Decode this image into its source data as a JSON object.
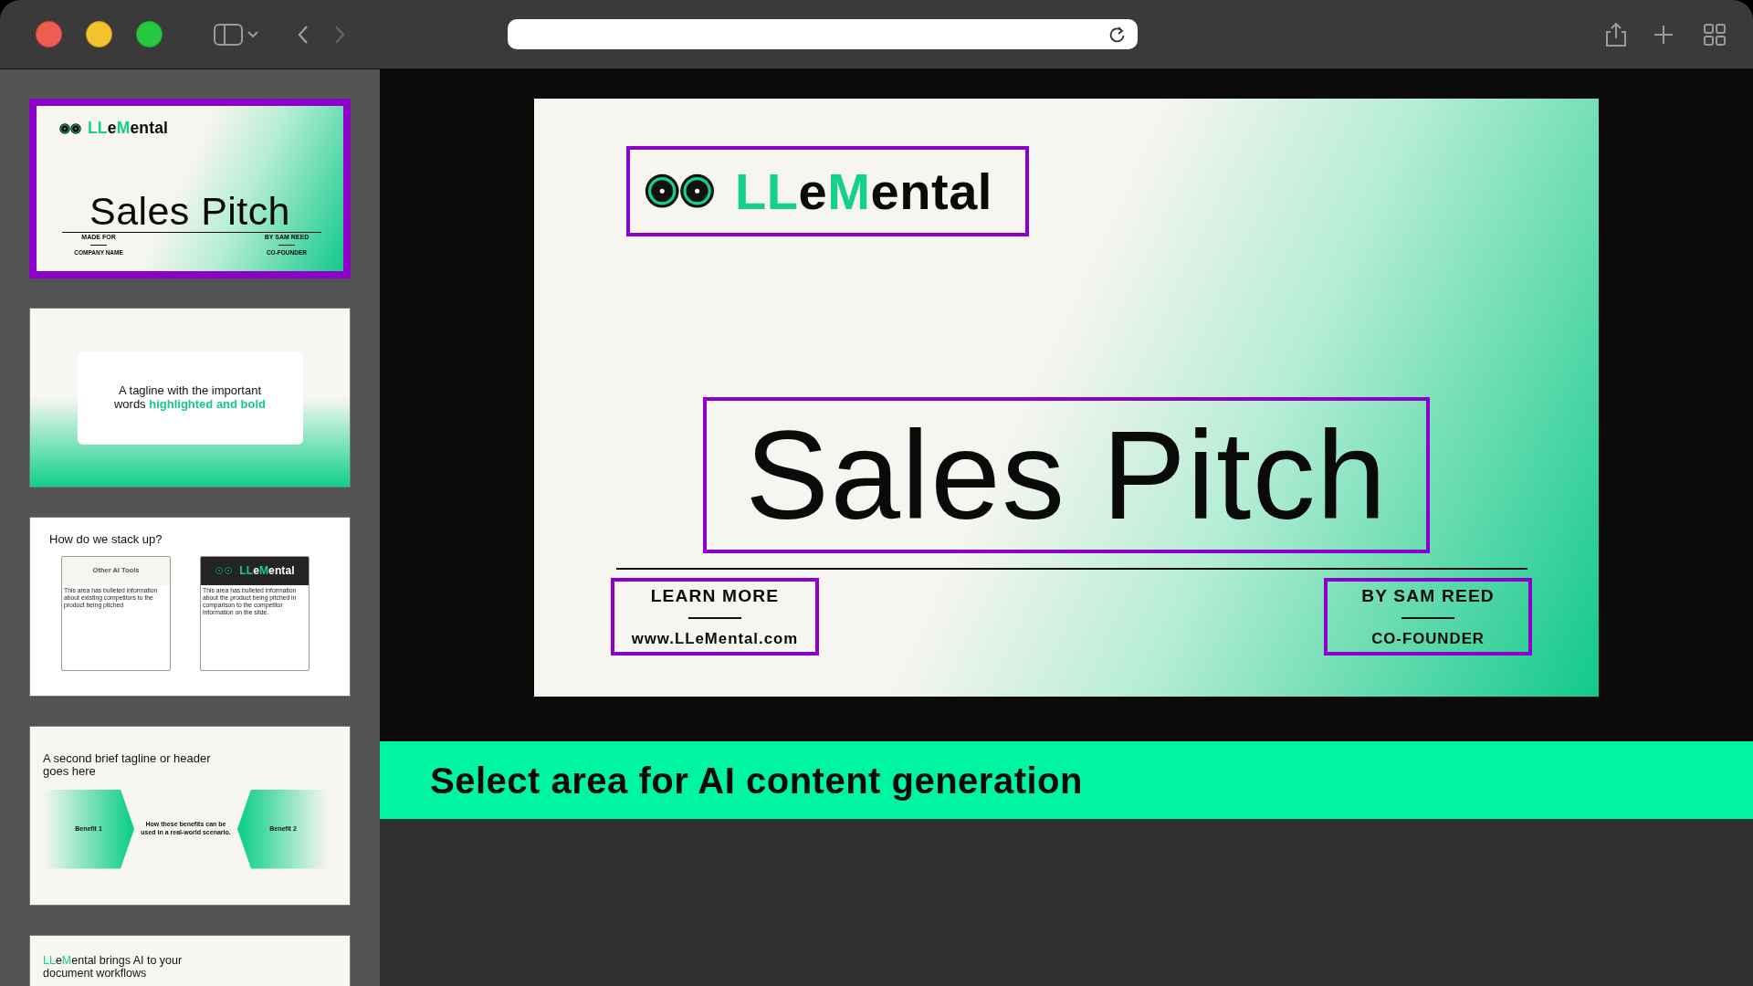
{
  "sidebar": {
    "slides": [
      {
        "kind": "title",
        "selected": true,
        "logo": [
          {
            "text": "LL",
            "accent": true
          },
          {
            "text": "e",
            "accent": false
          },
          {
            "text": "M",
            "accent": true
          },
          {
            "text": "ental",
            "accent": false
          }
        ],
        "title": "Sales Pitch",
        "left_label": "MADE FOR",
        "left_value": "COMPANY NAME",
        "right_label": "BY SAM REED",
        "right_value": "CO-FOUNDER"
      },
      {
        "kind": "tagline",
        "selected": false,
        "text": "A tagline with the important words **highlighted and bold**"
      },
      {
        "kind": "comparison",
        "selected": false,
        "title": "How do we stack up?",
        "left_header": "Other AI Tools",
        "left_body": "This area has bulleted information about existing competitors to the product being pitched",
        "right_logo": [
          {
            "text": "LL",
            "accent": true
          },
          {
            "text": "e",
            "accent": false
          },
          {
            "text": "M",
            "accent": true
          },
          {
            "text": "ental",
            "accent": false
          }
        ],
        "right_body": "This area has bulleted information about the product being pitched in comparison to the competitor information on the slide."
      },
      {
        "kind": "benefits",
        "selected": false,
        "title": "A second brief tagline or header goes here",
        "left": "Benefit 1",
        "middle": "How these benefits can be used in a real-world scenario.",
        "right": "Benefit 2"
      },
      {
        "kind": "statement",
        "selected": false,
        "heading": [
          {
            "text": "LL",
            "accent": true
          },
          {
            "text": "e",
            "accent": false
          },
          {
            "text": "M",
            "accent": true
          },
          {
            "text": "ental brings AI to your document workflows",
            "accent": false
          }
        ]
      }
    ]
  },
  "slide": {
    "kind": "title",
    "logo": [
      {
        "text": "LL",
        "accent": true
      },
      {
        "text": "e",
        "accent": false
      },
      {
        "text": "M",
        "accent": true
      },
      {
        "text": "ental",
        "accent": false
      }
    ],
    "title": "Sales Pitch",
    "left_label": "LEARN MORE",
    "left_value": "www.LLeMental.com",
    "right_label": "BY SAM REED",
    "right_value": "CO-FOUNDER"
  },
  "prompt_bar": {
    "text": "Select area for AI content generation"
  }
}
